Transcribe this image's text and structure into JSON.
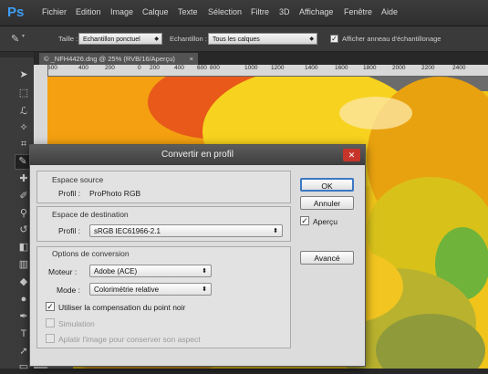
{
  "app": {
    "logo": "Ps"
  },
  "menu": [
    "Fichier",
    "Edition",
    "Image",
    "Calque",
    "Texte",
    "Sélection",
    "Filtre",
    "3D",
    "Affichage",
    "Fenêtre",
    "Aide"
  ],
  "options_bar": {
    "size_label": "Taille :",
    "size_value": "Echantillon ponctuel",
    "sample_label": "Echantillon :",
    "sample_value": "Tous les calques",
    "ring_label": "Afficher anneau d'échantillonage",
    "ring_checked": true
  },
  "document": {
    "tab_title": "© _NFH4426.dng @ 25% (RVB/16/Aperçu)",
    "tab_close": "×",
    "ruler_marks": [
      "600",
      "400",
      "200",
      "0",
      "200",
      "400",
      "600",
      "800",
      "1000",
      "1200",
      "1400",
      "1600",
      "1800",
      "2000",
      "2200",
      "2400"
    ]
  },
  "dialog": {
    "title": "Convertir en profil",
    "close": "✕",
    "source": {
      "heading": "Espace source",
      "profile_label": "Profil :",
      "profile_value": "ProPhoto RGB"
    },
    "destination": {
      "heading": "Espace de destination",
      "profile_label": "Profil :",
      "profile_value": "sRGB IEC61966-2.1"
    },
    "conversion": {
      "heading": "Options de conversion",
      "engine_label": "Moteur :",
      "engine_value": "Adobe (ACE)",
      "mode_label": "Mode :",
      "mode_value": "Colorimétrie relative",
      "black_point_label": "Utiliser la compensation du point noir",
      "black_point_checked": true,
      "simulation_label": "Simulation",
      "simulation_checked": false,
      "flatten_label": "Aplatir l'image pour conserver son aspect",
      "flatten_checked": false
    },
    "buttons": {
      "ok": "OK",
      "cancel": "Annuler",
      "preview": "Aperçu",
      "preview_checked": true,
      "advanced": "Avancé"
    }
  }
}
